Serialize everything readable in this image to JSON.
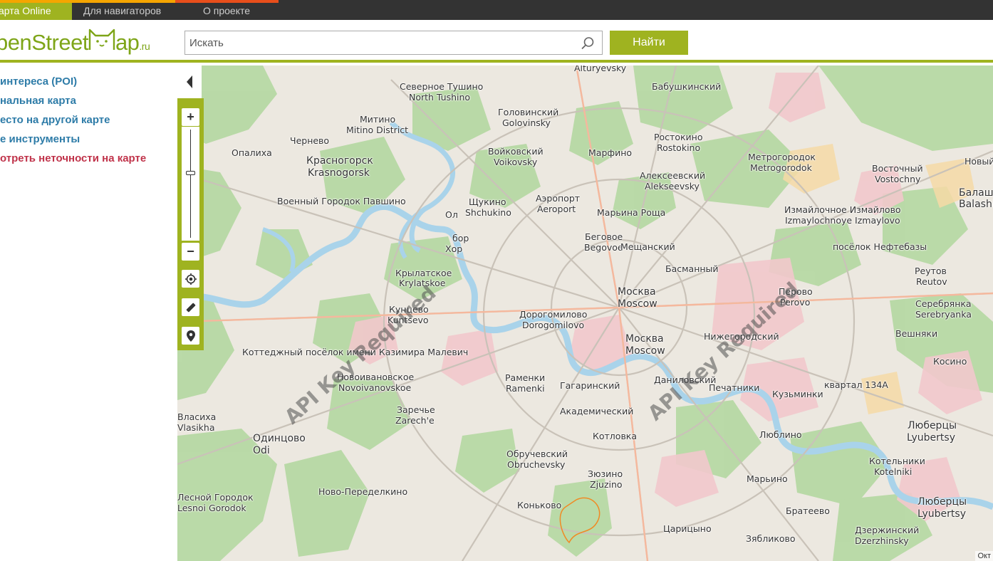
{
  "topbar": {
    "tabs": [
      {
        "label": "арта Online",
        "accent": "#f5a500"
      },
      {
        "label": "Для навигаторов",
        "accent": "#f5a500"
      },
      {
        "label": "О проекте",
        "accent": "#e84e1b"
      }
    ]
  },
  "header": {
    "logo_text": "penStreet",
    "logo_text2": "ap",
    "logo_suffix": ".ru",
    "search_placeholder": "Искать",
    "search_icon": "magnifier-icon",
    "find_label": "Найти"
  },
  "sidebar": {
    "items": [
      {
        "label": "интереса (POI)",
        "style": "blue"
      },
      {
        "label": "нальная карта",
        "style": "blue"
      },
      {
        "label": "есто на другой карте",
        "style": "blue"
      },
      {
        "label": "е инструменты",
        "style": "blue"
      },
      {
        "label": "отреть неточности на карте",
        "style": "red"
      }
    ]
  },
  "map": {
    "controls": {
      "collapse_icon": "triangle-left-icon",
      "zoom_in": "+",
      "zoom_out": "−",
      "zoom_level_fraction": 0.4,
      "locate_icon": "locate-icon",
      "ruler_icon": "ruler-icon",
      "marker_icon": "map-pin-icon"
    },
    "watermark": "API Key Required",
    "attribution": "Окт",
    "labels": [
      "Alturyevsky",
      "Северное Тушино",
      "North Tushino",
      "Бабушкинский",
      "Головинский",
      "Golovinsky",
      "Митино",
      "Mitino District",
      "Ростокино",
      "Rostokino",
      "Чернево",
      "Опалиха",
      "Красногорск",
      "Krasnogorsk",
      "Войковский",
      "Voikovsky",
      "Марфино",
      "Метрогородок",
      "Metrogorodok",
      "Восточный",
      "Vostochny",
      "Новый",
      "Алексеевский",
      "Alekseevsky",
      "Балаши",
      "Balashi",
      "Аэропорт",
      "Aeroport",
      "Щукино",
      "Shchukino",
      "Военный Городок Павшино",
      "Марьина Роща",
      "Измайлочное Измайлово",
      "Izmaylochnoye Izmaylovo",
      "Ол",
      "Беговое",
      "Begovoe",
      "бор",
      "Хор",
      "Мещанский",
      "посёлок Нефтебазы",
      "Басманный",
      "Крылатское",
      "Krylatskoe",
      "Реутов",
      "Reutov",
      "Москва",
      "Moscow",
      "Перово",
      "Perovo",
      "Кунцево",
      "Kuntsevo",
      "Серебрянка",
      "Serebryanka",
      "Дорогомилово",
      "Dorogomilovo",
      "Москва",
      "Moscow",
      "Нижегородский",
      "Вешняки",
      "Коттеджный посёлок имени Казимира Малевич",
      "Косино",
      "Новоивановское",
      "Novoivanovskoe",
      "Раменки",
      "Ramenki",
      "Даниловский",
      "Гагаринский",
      "Печатники",
      "Кузьминки",
      "квартал 134А",
      "Заречье",
      "Zarech'e",
      "Академический",
      "Власиха",
      "Vlasikha",
      "Люберцы",
      "Lyubertsy",
      "Котловка",
      "Люблино",
      "Одинцово",
      "Odi",
      "Обручевский",
      "Obruchevsky",
      "Котельники",
      "Kotelniki",
      "Зюзино",
      "Zjuzino",
      "Марьино",
      "Лесной Городок",
      "Lesnoi Gorodok",
      "Ново-Переделкино",
      "Люберцы",
      "Lyubertsy",
      "Коньково",
      "Братеево",
      "Царицыно",
      "Дзержинский",
      "Dzerzhinsky",
      "Зябликово"
    ]
  }
}
